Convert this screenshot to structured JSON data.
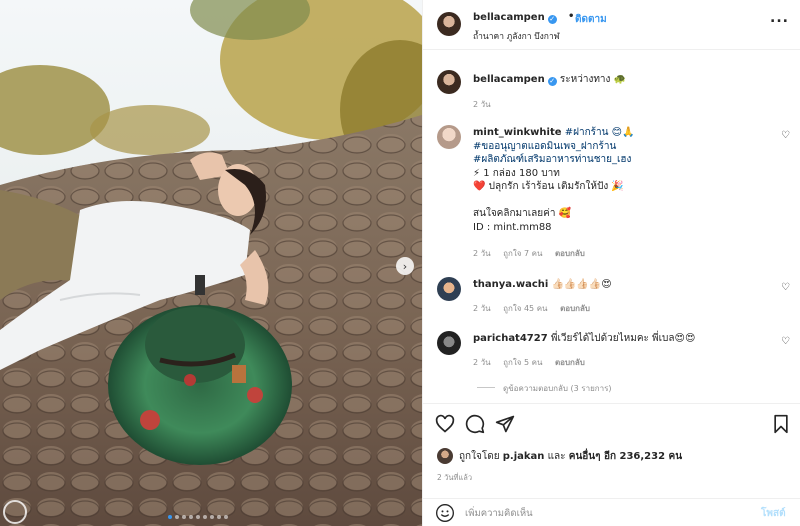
{
  "photo": {
    "alt_icon": "photo",
    "carousel_dot_count": 9,
    "active_dot": 0,
    "next_icon": "chevron-right-icon"
  },
  "header": {
    "username": "bellacampen",
    "verified_icon": "verified-badge-icon",
    "separator": "•",
    "follow_label": "ติดตาม",
    "location": "ถ้ำนาคา ภูลังกา บึงกาฬ",
    "more_label": "..."
  },
  "caption": {
    "username": "bellacampen",
    "text": "ระหว่างทาง 🐢",
    "time": "2 วัน"
  },
  "comments": [
    {
      "username": "mint_winkwhite",
      "lines": [
        "#ฝากร้าน 😊🙏",
        "#ขออนุญาตแอดมินเพจ_ฝากร้าน",
        "#ผลิตภัณฑ์เสริมอาหารท่านชาย_เฮง",
        "⚡ 1 กล่อง 180 บาท",
        "❤️ ปลุกรัก เร้าร้อน เติมรักให้ปัง 🎉",
        "",
        "สนใจคลิกมาเลยค่า 🥰",
        "ID : mint.mm88"
      ],
      "time": "2 วัน",
      "likes": "ถูกใจ 7 คน",
      "reply": "ตอบกลับ"
    },
    {
      "username": "thanya.wachi",
      "text": "👍🏻👍🏻👍🏻👍🏻😍",
      "time": "2 วัน",
      "likes": "ถูกใจ 45 คน",
      "reply": "ตอบกลับ"
    },
    {
      "username": "parichat4727",
      "text": "พี่เวียร์ได้ไปด้วยไหมคะ พี่เบล😍😍",
      "time": "2 วัน",
      "likes": "ถูกใจ 5 คน",
      "reply": "ตอบกลับ"
    }
  ],
  "view_replies": "ดูข้อความตอบกลับ (3 รายการ)",
  "actions": {
    "like_icon": "heart-icon",
    "comment_icon": "comment-icon",
    "share_icon": "paper-plane-icon",
    "save_icon": "bookmark-icon"
  },
  "likes_text": {
    "prefix": "ถูกใจโดย",
    "user": "p.jakan",
    "and": "และ",
    "others": "คนอื่นๆ อีก 236,232 คน"
  },
  "time_ago": "2 วันที่แล้ว",
  "add_comment": {
    "placeholder": "เพิ่มความคิดเห็น",
    "post_label": "โพสต์",
    "emoji_icon": "smiley-icon"
  },
  "colors": {
    "accent": "#3897f0",
    "link": "#00376b",
    "muted": "#8e8e8e",
    "border": "#efefef"
  }
}
